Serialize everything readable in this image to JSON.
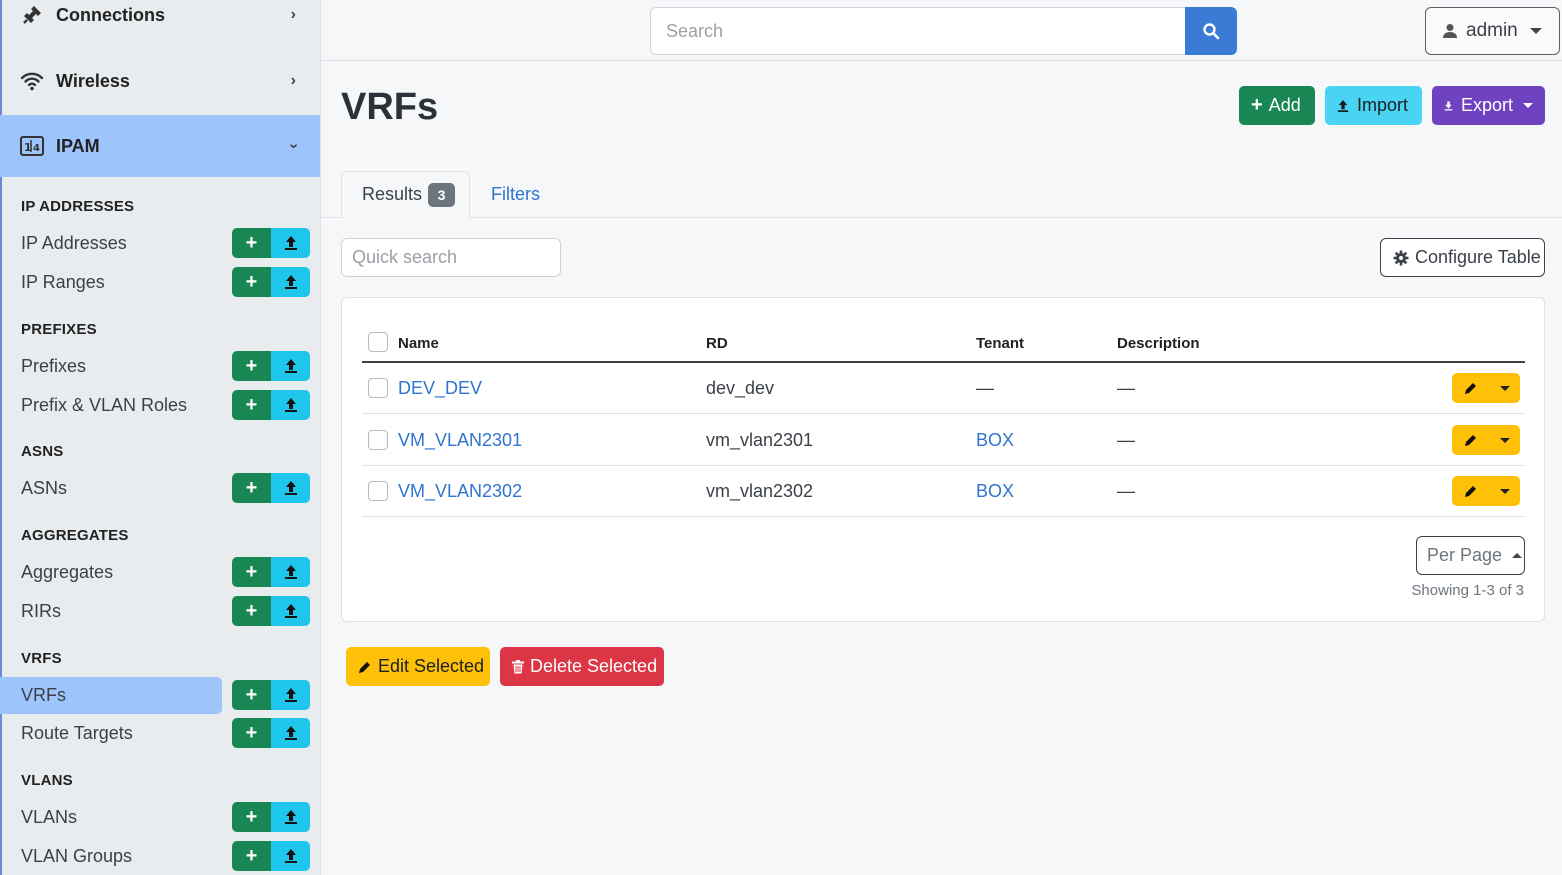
{
  "sidebar": {
    "top_items": [
      {
        "label": "Connections",
        "icon": "plug-icon"
      },
      {
        "label": "Wireless",
        "icon": "wifi-icon"
      },
      {
        "label": "IPAM",
        "icon": "ipam-icon"
      }
    ],
    "sections": [
      {
        "title": "IP ADDRESSES",
        "items": [
          {
            "label": "IP Addresses"
          },
          {
            "label": "IP Ranges"
          }
        ]
      },
      {
        "title": "PREFIXES",
        "items": [
          {
            "label": "Prefixes"
          },
          {
            "label": "Prefix & VLAN Roles"
          }
        ]
      },
      {
        "title": "ASNS",
        "items": [
          {
            "label": "ASNs"
          }
        ]
      },
      {
        "title": "AGGREGATES",
        "items": [
          {
            "label": "Aggregates"
          },
          {
            "label": "RIRs"
          }
        ]
      },
      {
        "title": "VRFS",
        "items": [
          {
            "label": "VRFs",
            "active": true
          },
          {
            "label": "Route Targets"
          }
        ]
      },
      {
        "title": "VLANS",
        "items": [
          {
            "label": "VLANs"
          },
          {
            "label": "VLAN Groups"
          }
        ]
      }
    ]
  },
  "header": {
    "search_placeholder": "Search",
    "user": "admin"
  },
  "page": {
    "title": "VRFs",
    "add_label": "Add",
    "import_label": "Import",
    "export_label": "Export",
    "tabs": {
      "results": "Results",
      "results_count": "3",
      "filters": "Filters"
    },
    "quick_search_placeholder": "Quick search",
    "configure_table": "Configure Table"
  },
  "table": {
    "columns": [
      "Name",
      "RD",
      "Tenant",
      "Description"
    ],
    "rows": [
      {
        "name": "DEV_DEV",
        "rd": "dev_dev",
        "tenant": "—",
        "description": "—"
      },
      {
        "name": "VM_VLAN2301",
        "rd": "vm_vlan2301",
        "tenant": "BOX",
        "description": "—"
      },
      {
        "name": "VM_VLAN2302",
        "rd": "vm_vlan2302",
        "tenant": "BOX",
        "description": "—"
      }
    ],
    "per_page": "Per Page",
    "showing": "Showing 1-3 of 3"
  },
  "bulk": {
    "edit_selected": "Edit Selected",
    "delete_selected": "Delete Selected"
  },
  "colors": {
    "success": "#198754",
    "info": "#1ec6eb",
    "primary": "#3a7bd5",
    "purple": "#6f42c1",
    "warning": "#ffc107",
    "danger": "#dc3545",
    "active_nav": "#9ec5fb"
  }
}
